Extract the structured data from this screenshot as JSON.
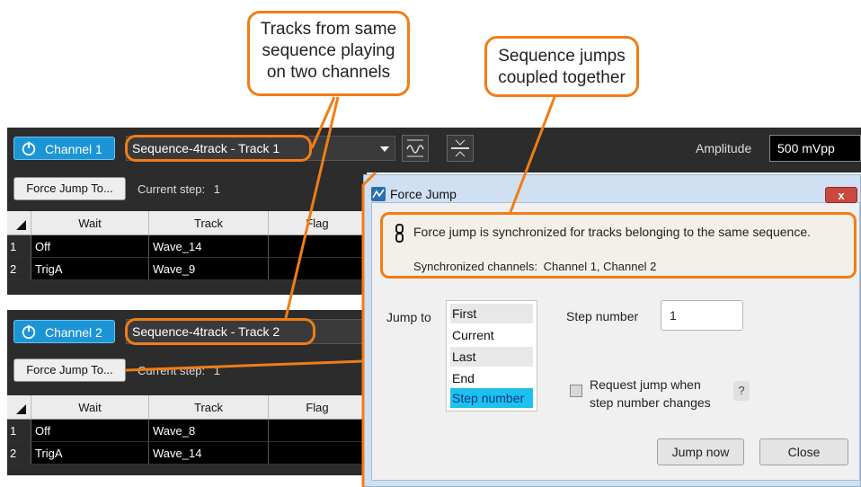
{
  "callouts": {
    "tracks_line1": "Tracks from same",
    "tracks_line2": "sequence playing",
    "tracks_line3": "on two channels",
    "jumps_line1": "Sequence jumps",
    "jumps_line2": "coupled together"
  },
  "channel1": {
    "button_label": "Channel 1",
    "sequence": "Sequence-4track - Track 1",
    "force_jump_label": "Force Jump To...",
    "current_step_label": "Current step:",
    "current_step_value": "1",
    "columns": [
      "Wait",
      "Track",
      "Flag"
    ],
    "rows": [
      {
        "idx": "1",
        "wait": "Off",
        "track": "Wave_14"
      },
      {
        "idx": "2",
        "wait": "TrigA",
        "track": "Wave_9"
      }
    ]
  },
  "channel2": {
    "button_label": "Channel 2",
    "sequence": "Sequence-4track - Track 2",
    "force_jump_label": "Force Jump To...",
    "current_step_label": "Current step:",
    "current_step_value": "1",
    "columns": [
      "Wait",
      "Track",
      "Flag"
    ],
    "rows": [
      {
        "idx": "1",
        "wait": "Off",
        "track": "Wave_8"
      },
      {
        "idx": "2",
        "wait": "TrigA",
        "track": "Wave_14"
      }
    ]
  },
  "toolbar": {
    "amplitude_label": "Amplitude",
    "amplitude_value": "500 mVpp"
  },
  "dialog": {
    "title": "Force Jump",
    "close_x": "x",
    "sync_message": "Force jump is synchronized for tracks belonging to the same sequence.",
    "sync_channels_label": "Synchronized channels:",
    "sync_channels_value": "Channel 1, Channel 2",
    "jump_to_label": "Jump to",
    "jump_options": [
      "First",
      "Current",
      "Last",
      "End",
      "Step number"
    ],
    "selected_option": "Step number",
    "step_number_label": "Step number",
    "step_number_value": "1",
    "request_jump_line1": "Request jump when",
    "request_jump_line2": "step number changes",
    "help_label": "?",
    "jump_now_label": "Jump now",
    "close_label": "Close"
  },
  "colors": {
    "accent": "#f07d16",
    "channel_button": "#1b95d6",
    "selected_item": "#1ec0ee",
    "panel_bg": "#2c2c2c"
  }
}
